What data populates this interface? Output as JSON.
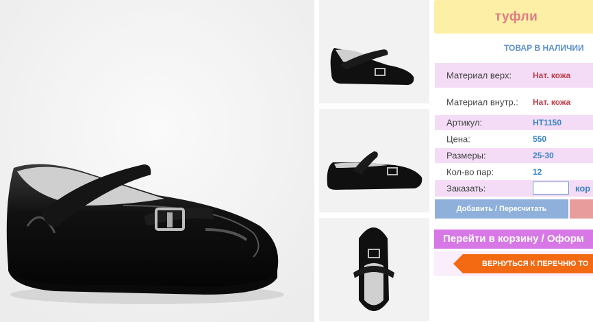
{
  "product": {
    "title": "туфли",
    "stock_status": "ТОВАР В НАЛИЧИИ"
  },
  "specs": [
    {
      "label": "Материал верх:",
      "value": "Нат. кожа"
    },
    {
      "label": "Материал внутр.:",
      "value": "Нат. кожа"
    },
    {
      "label": "Артикул:",
      "value": "HT1150"
    },
    {
      "label": "Цена:",
      "value": "550"
    },
    {
      "label": "Размеры:",
      "value": "25-30"
    },
    {
      "label": "Кол-во пар:",
      "value": "12"
    }
  ],
  "order": {
    "label": "Заказать:",
    "input_value": "",
    "suffix": "кор"
  },
  "buttons": {
    "add": "Добавить / Пересчитать",
    "cart": "Перейти в корзину / Оформ",
    "back": "ВЕРНУТЬСЯ К ПЕРЕЧНЮ ТО"
  },
  "colors": {
    "title_bg": "#fdf0a6",
    "title_text": "#e27a86",
    "row_pink": "#f4dcf6",
    "value_red": "#c0404a",
    "value_blue": "#3a86c8",
    "add_button": "#8eb0da",
    "cart_button": "#d778e6",
    "back_button": "#f36a12"
  }
}
